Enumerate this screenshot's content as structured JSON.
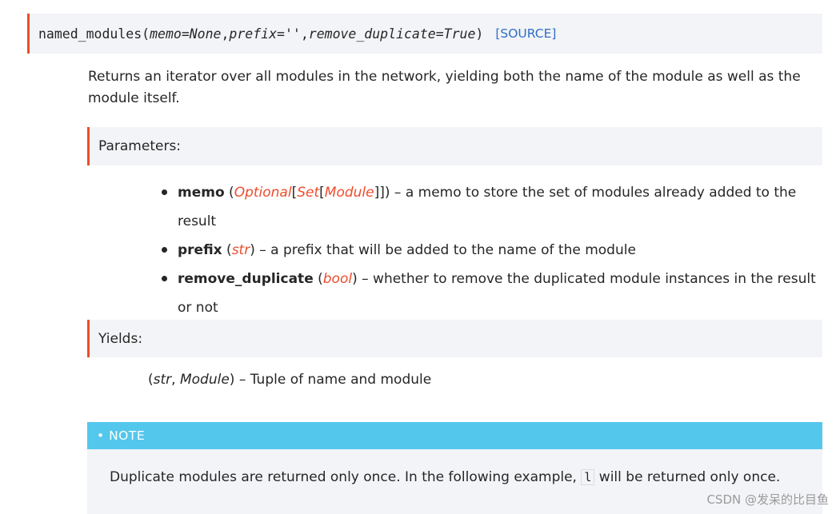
{
  "signature": {
    "name": "named_modules",
    "open_paren": "(",
    "param_memo": "memo=None",
    "sep1": ", ",
    "param_prefix": "prefix=''",
    "sep2": ", ",
    "param_remove_duplicate": "remove_duplicate=True",
    "close_paren": ")",
    "source_link": "[SOURCE]"
  },
  "description": "Returns an iterator over all modules in the network, yielding both the name of the module as well as the module itself.",
  "parameters": {
    "heading": "Parameters:",
    "items": [
      {
        "name": "memo",
        "type_open": " (",
        "type_parts": [
          "Optional",
          "[",
          "Set",
          "[",
          "Module",
          "]]"
        ],
        "type_close": ")",
        "desc": " – a memo to store the set of modules already added to the result"
      },
      {
        "name": "prefix",
        "type_open": " (",
        "type_parts": [
          "str"
        ],
        "type_close": ")",
        "desc": " – a prefix that will be added to the name of the module"
      },
      {
        "name": "remove_duplicate",
        "type_open": " (",
        "type_parts": [
          "bool"
        ],
        "type_close": ")",
        "desc": " – whether to remove the duplicated module instances in the result or not"
      }
    ]
  },
  "yields": {
    "heading": "Yields:",
    "open": "(",
    "type1": "str",
    "comma": ", ",
    "type2": "Module",
    "close": ")",
    "desc": " – Tuple of name and module"
  },
  "note": {
    "heading": "• NOTE",
    "text_before": "Duplicate modules are returned only once. In the following example, ",
    "code": "l",
    "text_after": " will be returned only once."
  },
  "watermark": "CSDN @发呆的比目鱼",
  "colors": {
    "accent": "#ee4c2c",
    "link": "#2f6ec4",
    "note_header": "#54c7ec",
    "panel_bg": "#f3f4f7"
  }
}
